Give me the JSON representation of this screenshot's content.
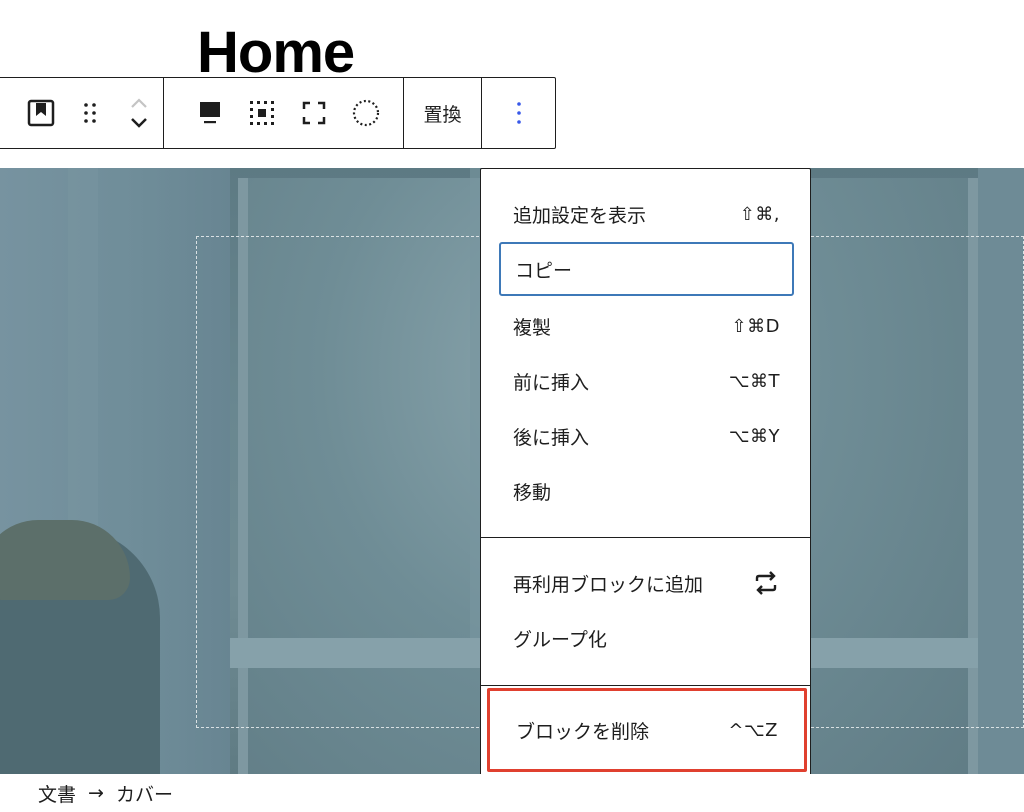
{
  "page": {
    "title": "Home"
  },
  "toolbar": {
    "replace_label": "置換"
  },
  "menu": {
    "section1": [
      {
        "label": "追加設定を表示",
        "shortcut": "⇧⌘,"
      },
      {
        "label": "コピー",
        "shortcut": ""
      },
      {
        "label": "複製",
        "shortcut": "⇧⌘D"
      },
      {
        "label": "前に挿入",
        "shortcut": "⌥⌘T"
      },
      {
        "label": "後に挿入",
        "shortcut": "⌥⌘Y"
      },
      {
        "label": "移動",
        "shortcut": ""
      }
    ],
    "section2": [
      {
        "label": "再利用ブロックに追加"
      },
      {
        "label": "グループ化"
      }
    ],
    "section3": [
      {
        "label": "ブロックを削除",
        "shortcut": "^⌥Z"
      }
    ]
  },
  "breadcrumb": {
    "items": [
      "文書",
      "カバー"
    ],
    "separator": "→"
  },
  "colors": {
    "focus": "#3e79b8",
    "highlight": "#e0402f",
    "accent": "#3858e9"
  }
}
